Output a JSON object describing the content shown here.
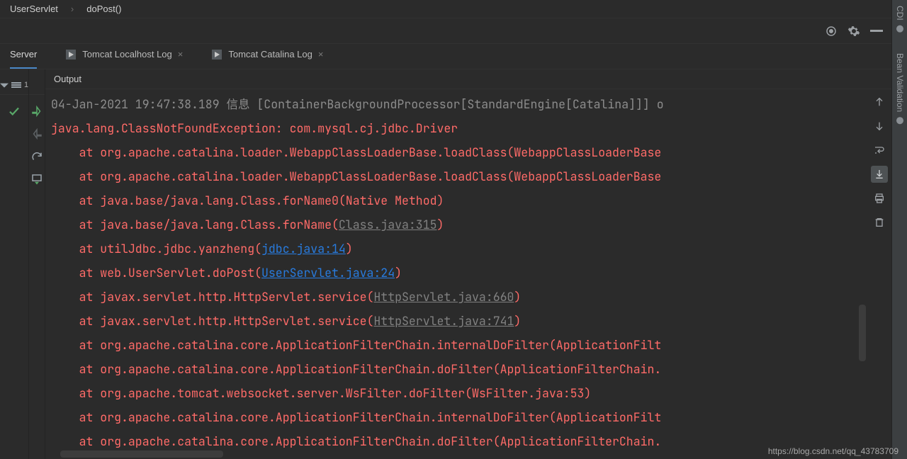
{
  "breadcrumb": {
    "class": "UserServlet",
    "method": "doPost()"
  },
  "tabs": {
    "server": "Server",
    "localhost": "Tomcat Localhost Log",
    "catalina": "Tomcat Catalina Log"
  },
  "run": {
    "threads_label": "1",
    "output_header": "Output"
  },
  "right_rail": {
    "cdi": "CDI",
    "bean": "Bean Validation"
  },
  "console": {
    "cutoff_top": "04-Jan-2021 19:47:38.189 信息 [ContainerBackgroundProcessor[StandardEngine[Catalina]]] o",
    "exception": "java.lang.ClassNotFoundException: com.mysql.cj.jdbc.Driver",
    "lines": [
      {
        "pre": "    at org.apache.catalina.loader.WebappClassLoaderBase.loadClass(WebappClassLoaderBase"
      },
      {
        "pre": "    at org.apache.catalina.loader.WebappClassLoaderBase.loadClass(WebappClassLoaderBase"
      },
      {
        "pre": "    at java.base/java.lang.Class.forName0(Native Method)"
      },
      {
        "pre": "    at java.base/java.lang.Class.forName(",
        "link": "Class.java:315",
        "cls": "glink",
        "post": ")"
      },
      {
        "pre": "    at utilJdbc.jdbc.yanzheng(",
        "link": "jdbc.java:14",
        "cls": "link",
        "post": ")"
      },
      {
        "pre": "    at web.UserServlet.doPost(",
        "link": "UserServlet.java:24",
        "cls": "link",
        "post": ")"
      },
      {
        "pre": "    at javax.servlet.http.HttpServlet.service(",
        "link": "HttpServlet.java:660",
        "cls": "glink",
        "post": ")"
      },
      {
        "pre": "    at javax.servlet.http.HttpServlet.service(",
        "link": "HttpServlet.java:741",
        "cls": "glink",
        "post": ")"
      },
      {
        "pre": "    at org.apache.catalina.core.ApplicationFilterChain.internalDoFilter(ApplicationFilt"
      },
      {
        "pre": "    at org.apache.catalina.core.ApplicationFilterChain.doFilter(ApplicationFilterChain."
      },
      {
        "pre": "    at org.apache.tomcat.websocket.server.WsFilter.doFilter(WsFilter.java:53)"
      },
      {
        "pre": "    at org.apache.catalina.core.ApplicationFilterChain.internalDoFilter(ApplicationFilt"
      },
      {
        "pre": "    at org.apache.catalina.core.ApplicationFilterChain.doFilter(ApplicationFilterChain."
      }
    ]
  },
  "watermark": "https://blog.csdn.net/qq_43783709"
}
